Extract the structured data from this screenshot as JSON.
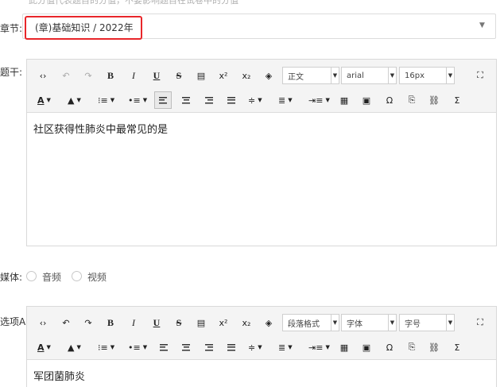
{
  "top_hint": "此分值代表题目的分值，不要影响题目在试卷中的分值",
  "chapter": {
    "label": "章节:",
    "value": "(章)基础知识 / 2022年",
    "arrow": "▼"
  },
  "stem": {
    "label": "题干:",
    "toolbar": {
      "paragraph": "正文",
      "font": "arial",
      "size": "16px"
    },
    "content": "社区获得性肺炎中最常见的是"
  },
  "media": {
    "label": "媒体:",
    "options": [
      "音频",
      "视频"
    ]
  },
  "option_a": {
    "label": "选项A:",
    "toolbar": {
      "paragraph": "段落格式",
      "font": "字体",
      "size": "字号"
    },
    "content": "军团菌肺炎"
  },
  "toolbar_icons": {
    "source": "‹›",
    "undo": "↶",
    "redo": "↷",
    "bold": "B",
    "italic": "I",
    "underline": "U",
    "strike": "S",
    "blockquote": "▤",
    "superscript": "x²",
    "subscript": "x₂",
    "eraser": "◈",
    "fullscreen": "⛶",
    "fontcolor": "A",
    "bgcolor": "▲",
    "orderedlist": "⁝≡",
    "unorderedlist": "•≡",
    "lineheight": "≑",
    "paragraphspacing": "≣",
    "indent": "⇥≡",
    "table": "▦",
    "image": "▣",
    "specialchars": "Ω",
    "paste": "⎘",
    "link": "⛓",
    "formula": "Σ"
  }
}
